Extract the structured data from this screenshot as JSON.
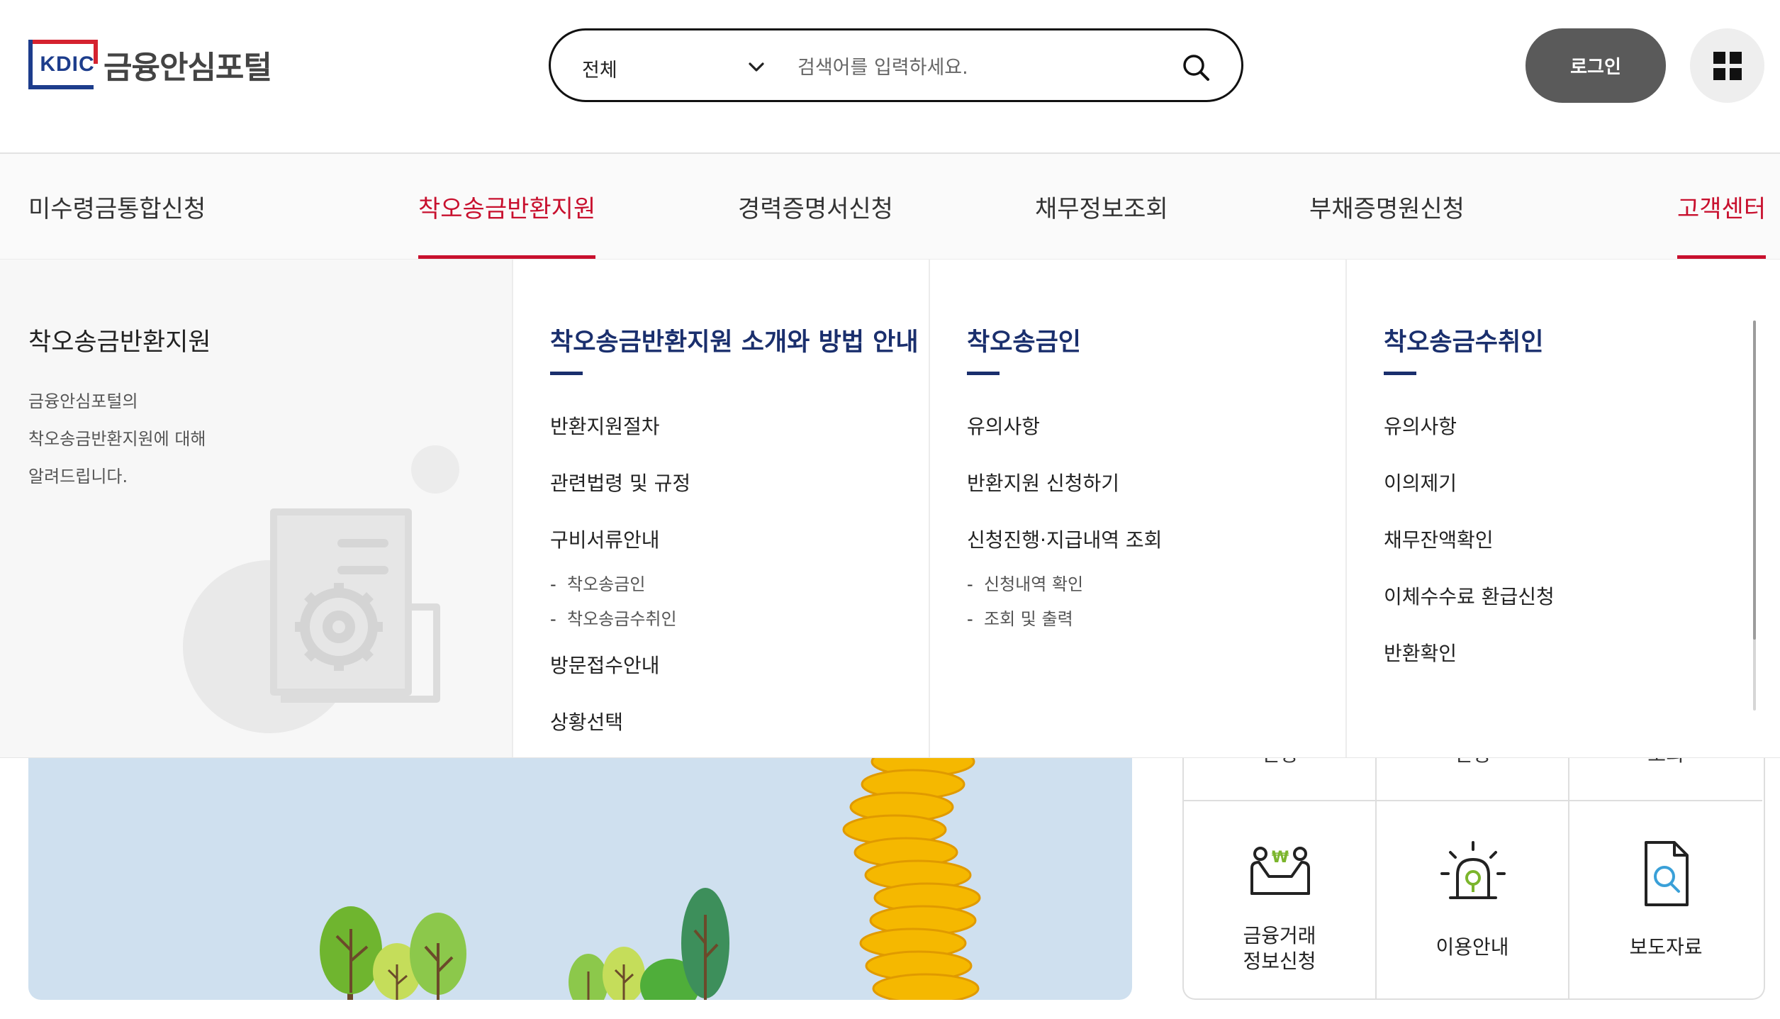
{
  "header": {
    "logo_letters": "KDIC",
    "logo_name": "금융안심포털",
    "search": {
      "scope": "전체",
      "placeholder": "검색어를 입력하세요."
    },
    "login_label": "로그인"
  },
  "nav": {
    "items": [
      {
        "label": "미수령금통합신청"
      },
      {
        "label": "착오송금반환지원"
      },
      {
        "label": "경력증명서신청"
      },
      {
        "label": "채무정보조회"
      },
      {
        "label": "부채증명원신청"
      },
      {
        "label": "고객센터"
      }
    ]
  },
  "dropdown": {
    "intro": {
      "title": "착오송금반환지원",
      "description": "금융안심포털의\n착오송금반환지원에 대해\n알려드립니다."
    },
    "columns": [
      {
        "title": "착오송금반환지원 소개와 방법 안내",
        "links": [
          "반환지원절차",
          "관련법령 및 규정",
          "구비서류안내",
          "방문접수안내",
          "상황선택"
        ],
        "sublinks": [
          "착오송금인",
          "착오송금수취인"
        ]
      },
      {
        "title": "착오송금인",
        "links": [
          "유의사항",
          "반환지원 신청하기",
          "신청진행·지급내역 조회"
        ],
        "sublinks": [
          "신청내역 확인",
          "조회 및 출력"
        ]
      },
      {
        "title": "착오송금수취인",
        "links": [
          "유의사항",
          "이의제기",
          "채무잔액확인",
          "이체수수료 환급신청",
          "반환확인"
        ]
      }
    ]
  },
  "quick_menu": {
    "partial_top_labels": [
      "신청",
      "신청",
      "조회"
    ],
    "tiles": [
      {
        "label": "금융거래\n정보신청",
        "icon": "handshake-icon"
      },
      {
        "label": "이용안내",
        "icon": "siren-icon"
      },
      {
        "label": "보도자료",
        "icon": "document-search-icon"
      }
    ]
  },
  "colors": {
    "accent_red": "#c8102e",
    "navy": "#1a2f6d",
    "login_bg": "#5a5a5a",
    "banner_bg": "#cfe0ef",
    "coin": "#f5b800"
  }
}
